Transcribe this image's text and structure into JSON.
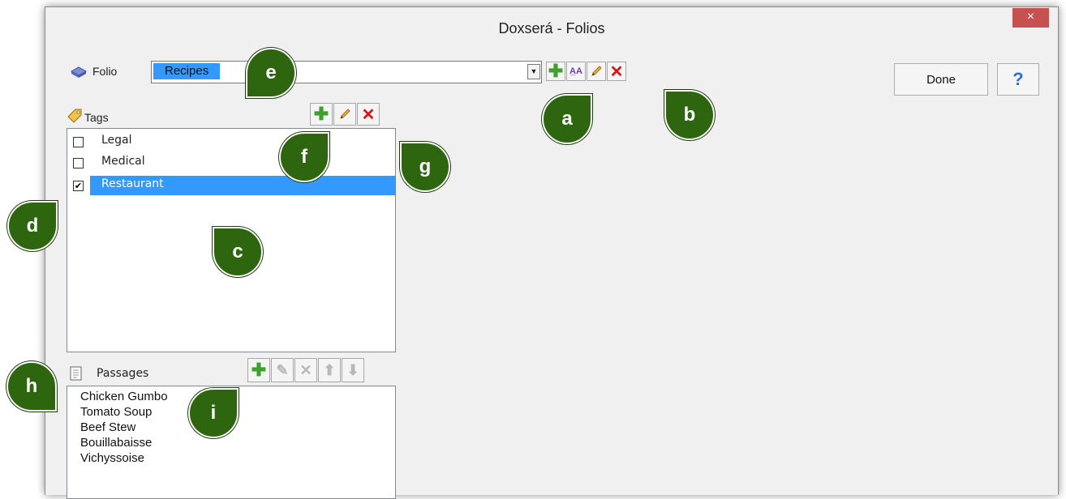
{
  "window": {
    "title": "Doxserá - Folios",
    "close_glyph": "×"
  },
  "folio": {
    "label": "Folio",
    "selected": "Recipes",
    "dropdown_glyph": "▼"
  },
  "folio_toolbar": {
    "add": "add-icon",
    "rename": "rename-icon",
    "edit": "edit-icon",
    "delete": "delete-icon",
    "rename_glyph": "A̲A"
  },
  "buttons": {
    "done": "Done",
    "help": "?"
  },
  "tags": {
    "label": "Tags",
    "items": [
      {
        "label": "Legal",
        "checked": false,
        "check": ""
      },
      {
        "label": "Medical",
        "checked": false,
        "check": ""
      },
      {
        "label": "Restaurant",
        "checked": true,
        "check": "✔",
        "selected": true
      }
    ]
  },
  "passages": {
    "label": "Passages",
    "items": [
      "Chicken Gumbo",
      "Tomato Soup",
      "Beef Stew",
      "Bouillabaisse",
      "Vichyssoise"
    ]
  },
  "callouts": {
    "a": "a",
    "b": "b",
    "c": "c",
    "d": "d",
    "e": "e",
    "f": "f",
    "g": "g",
    "h": "h",
    "i": "i"
  },
  "glyphs": {
    "plus": "✚",
    "x": "✕",
    "pencil": "✎",
    "up": "⬆",
    "down": "⬇"
  },
  "colors": {
    "selection": "#3399ff",
    "callout": "#2e6610",
    "close": "#c75050",
    "help": "#2f6fd0"
  }
}
